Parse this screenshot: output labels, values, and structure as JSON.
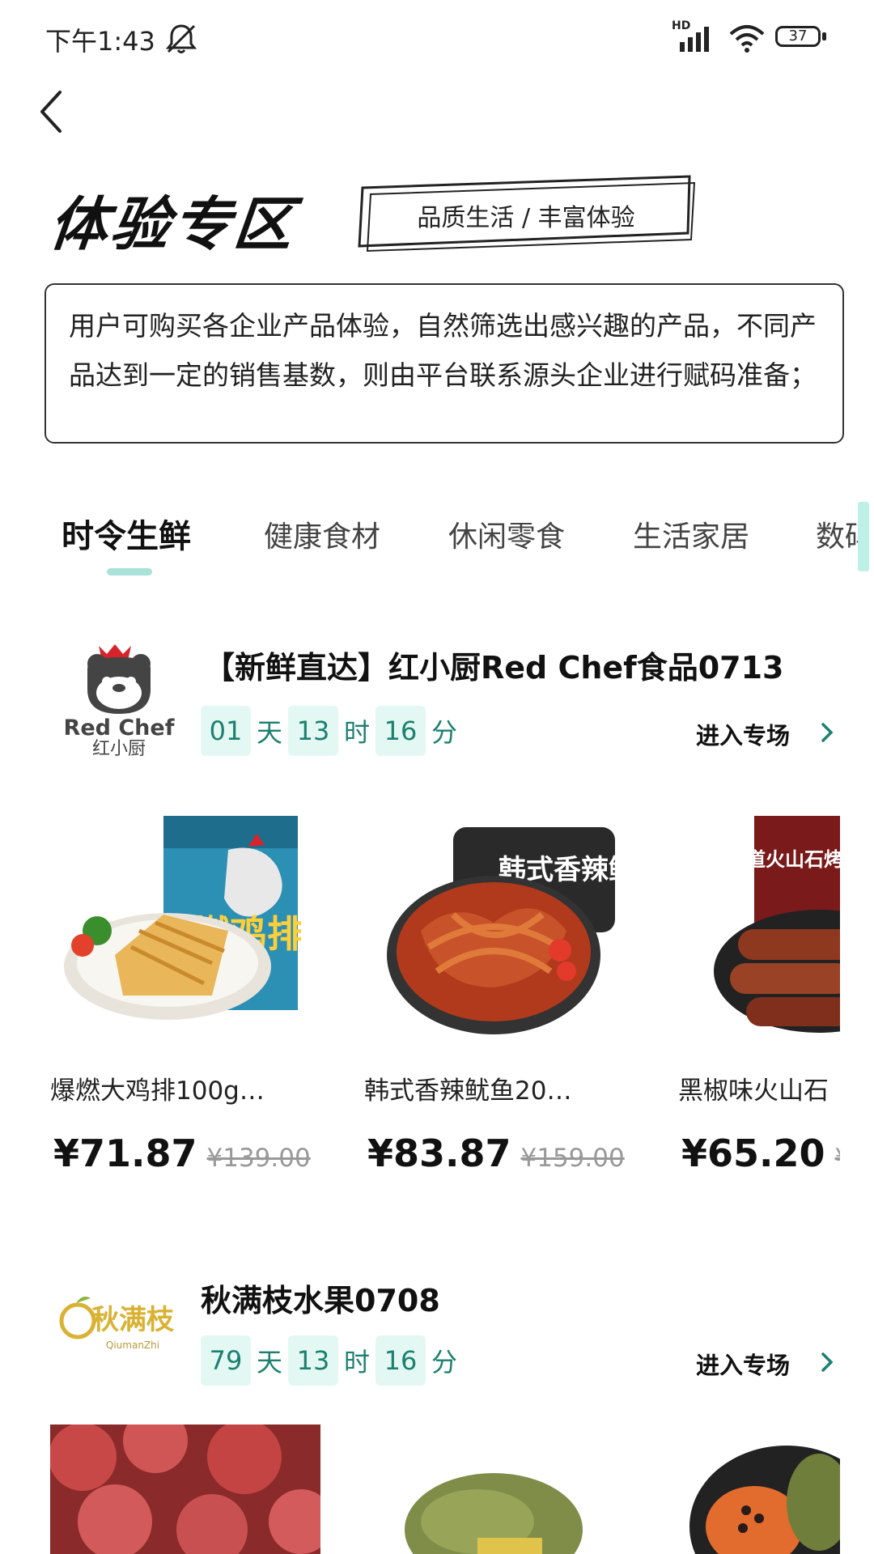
{
  "status_bar": {
    "time": "下午1:43",
    "network": "HD",
    "battery": "37"
  },
  "header": {
    "title": "体验专区",
    "slogan": "品质生活 / 丰富体验"
  },
  "intro": {
    "text": "用户可购买各企业产品体验，自然筛选出感兴趣的产品，不同产品达到一定的销售基数，则由平台联系源头企业进行赋码准备；"
  },
  "tabs": [
    {
      "label": "时令生鲜",
      "active": true
    },
    {
      "label": "健康食材",
      "active": false
    },
    {
      "label": "休闲零食",
      "active": false
    },
    {
      "label": "生活家居",
      "active": false
    },
    {
      "label": "数码",
      "active": false
    }
  ],
  "shops": [
    {
      "title": "【新鲜直达】红小厨Red Chef食品0713",
      "logo_text_1": "Red Chef",
      "logo_text_2": "红小厨",
      "countdown": {
        "days": "01",
        "days_unit": "天",
        "hours": "13",
        "hours_unit": "时",
        "minutes": "16",
        "minutes_unit": "分"
      },
      "enter_label": "进入专场",
      "products": [
        {
          "name": "爆燃大鸡排100g…",
          "price": "¥71.87",
          "old_price": "¥139.00",
          "pack_text": "爆燃鸡排"
        },
        {
          "name": "韩式香辣鱿鱼20…",
          "price": "¥83.87",
          "old_price": "¥159.00",
          "pack_text": "韩式香辣鱿鱼"
        },
        {
          "name": "黑椒味火山石",
          "price": "¥65.20",
          "old_price": "¥",
          "pack_text": "地道火山石烤肠"
        }
      ]
    },
    {
      "title": "秋满枝水果0708",
      "logo_text_1": "秋满枝",
      "logo_text_2": "QiumanZhi",
      "countdown": {
        "days": "79",
        "days_unit": "天",
        "hours": "13",
        "hours_unit": "时",
        "minutes": "16",
        "minutes_unit": "分"
      },
      "enter_label": "进入专场",
      "products": [
        {
          "name": "",
          "price": "",
          "old_price": ""
        },
        {
          "name": "",
          "price": "",
          "old_price": ""
        },
        {
          "name": "",
          "price": "",
          "old_price": ""
        }
      ]
    }
  ],
  "colors": {
    "accent": "#1c8070",
    "accent_bg": "#e3f8f3",
    "tab_underline": "#a8e2d8"
  }
}
